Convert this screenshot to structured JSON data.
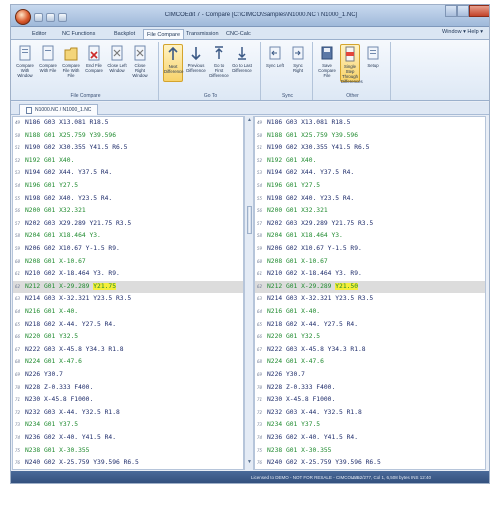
{
  "window": {
    "title": "CIMCOEdit 7 - Compare [C:\\CIMCO\\Samples\\N1000.NC \\ N1000_1.NC]"
  },
  "menu_tabs": [
    "Editor",
    "NC Functions",
    "Backplot",
    "File Compare",
    "Transmission",
    "CNC-Calc"
  ],
  "window_menu": "Window ▾ Help ▾",
  "ribbon": {
    "groups": [
      {
        "label": "File Compare",
        "buttons": [
          "Compare With Window",
          "Compare With File",
          "Compare File With File",
          "End File Compare",
          "Close Left Window",
          "Close Right Window"
        ]
      },
      {
        "label": "Go To",
        "buttons": [
          "Next Difference",
          "Previous Difference",
          "Go to First Difference",
          "Go to Last Difference"
        ]
      },
      {
        "label": "Sync",
        "buttons": [
          "Sync Left",
          "Sync Right"
        ]
      },
      {
        "label": "Other",
        "buttons": [
          "Save Compare File",
          "Single Step Through Differences",
          "Setup"
        ]
      }
    ]
  },
  "doc_tab": "N1000.NC / N1000_1.NC",
  "left_lines": [
    {
      "num": "49",
      "code": "N186 G03 X13.081 R18.5"
    },
    {
      "num": "50",
      "code": "N188 G01 X25.759 Y39.596"
    },
    {
      "num": "51",
      "code": "N190 G02 X30.355 Y41.5 R6.5"
    },
    {
      "num": "52",
      "code": "N192 G01 X40."
    },
    {
      "num": "53",
      "code": "N194 G02 X44. Y37.5 R4."
    },
    {
      "num": "54",
      "code": "N196 G01 Y27.5"
    },
    {
      "num": "55",
      "code": "N198 G02 X40. Y23.5 R4."
    },
    {
      "num": "56",
      "code": "N200 G01 X32.321"
    },
    {
      "num": "57",
      "code": "N202 G03 X29.289 Y21.75 R3.5"
    },
    {
      "num": "58",
      "code": "N204 G01 X18.464 Y3."
    },
    {
      "num": "59",
      "code": "N206 G02 X10.67 Y-1.5 R9."
    },
    {
      "num": "60",
      "code": "N208 G01 X-10.67"
    },
    {
      "num": "61",
      "code": "N210 G02 X-18.464 Y3. R9."
    },
    {
      "num": "62",
      "code": "N212 G01 X-29.289 Y21.75"
    },
    {
      "num": "63",
      "code": "N214 G03 X-32.321 Y23.5 R3.5"
    },
    {
      "num": "64",
      "code": "N216 G01 X-40."
    },
    {
      "num": "65",
      "code": "N218 G02 X-44. Y27.5 R4."
    },
    {
      "num": "66",
      "code": "N220 G01 Y32.5"
    },
    {
      "num": "67",
      "code": "N222 G03 X-45.8 Y34.3 R1.8"
    },
    {
      "num": "68",
      "code": "N224 G01 X-47.6"
    },
    {
      "num": "69",
      "code": "N226 Y30.7"
    },
    {
      "num": "70",
      "code": "N228 Z-0.333 F400."
    },
    {
      "num": "71",
      "code": "N230 X-45.8 F1000."
    },
    {
      "num": "72",
      "code": "N232 G03 X-44. Y32.5 R1.8"
    },
    {
      "num": "73",
      "code": "N234 G01 Y37.5"
    },
    {
      "num": "74",
      "code": "N236 G02 X-40. Y41.5 R4."
    },
    {
      "num": "75",
      "code": "N238 G01 X-30.355"
    },
    {
      "num": "76",
      "code": "N240 G02 X-25.759 Y39.596 R6.5"
    }
  ],
  "right_lines": [
    {
      "num": "49",
      "code": "N186 G03 X13.081 R18.5"
    },
    {
      "num": "50",
      "code": "N188 G01 X25.759 Y39.596"
    },
    {
      "num": "51",
      "code": "N190 G02 X30.355 Y41.5 R6.5"
    },
    {
      "num": "52",
      "code": "N192 G01 X40."
    },
    {
      "num": "53",
      "code": "N194 G02 X44. Y37.5 R4."
    },
    {
      "num": "54",
      "code": "N196 G01 Y27.5"
    },
    {
      "num": "55",
      "code": "N198 G02 X40. Y23.5 R4."
    },
    {
      "num": "56",
      "code": "N200 G01 X32.321"
    },
    {
      "num": "57",
      "code": "N202 G03 X29.289 Y21.75 R3.5"
    },
    {
      "num": "58",
      "code": "N204 G01 X18.464 Y3."
    },
    {
      "num": "59",
      "code": "N206 G02 X10.67 Y-1.5 R9."
    },
    {
      "num": "60",
      "code": "N208 G01 X-10.67"
    },
    {
      "num": "61",
      "code": "N210 G02 X-18.464 Y3. R9."
    },
    {
      "num": "62",
      "code": "N212 G01 X-29.289 Y21.50"
    },
    {
      "num": "63",
      "code": "N214 G03 X-32.321 Y23.5 R3.5"
    },
    {
      "num": "64",
      "code": "N216 G01 X-40."
    },
    {
      "num": "65",
      "code": "N218 G02 X-44. Y27.5 R4."
    },
    {
      "num": "66",
      "code": "N220 G01 Y32.5"
    },
    {
      "num": "67",
      "code": "N222 G03 X-45.8 Y34.3 R1.8"
    },
    {
      "num": "68",
      "code": "N224 G01 X-47.6"
    },
    {
      "num": "69",
      "code": "N226 Y30.7"
    },
    {
      "num": "70",
      "code": "N228 Z-0.333 F400."
    },
    {
      "num": "71",
      "code": "N230 X-45.8 F1000."
    },
    {
      "num": "72",
      "code": "N232 G03 X-44. Y32.5 R1.8"
    },
    {
      "num": "73",
      "code": "N234 G01 Y37.5"
    },
    {
      "num": "74",
      "code": "N236 G02 X-40. Y41.5 R4."
    },
    {
      "num": "75",
      "code": "N238 G01 X-30.355"
    },
    {
      "num": "76",
      "code": "N240 G02 X-25.759 Y39.596 R6.5"
    }
  ],
  "highlight_line": "62",
  "diff": {
    "left": "Y21.75",
    "right": "Y21.50"
  },
  "status": {
    "left": "Licensed to DEMO - NOT FOR RESALE - CIMCO 4.5",
    "right": "Ln 62/277, Col 1, 6,508 bytes   INS   12:40"
  },
  "colors": {
    "code_blue": "#1f2d6b",
    "g01_green": "#1e8a2e",
    "diff_yellow": "#f5ee3a",
    "status_bar": "#2f4c79"
  }
}
